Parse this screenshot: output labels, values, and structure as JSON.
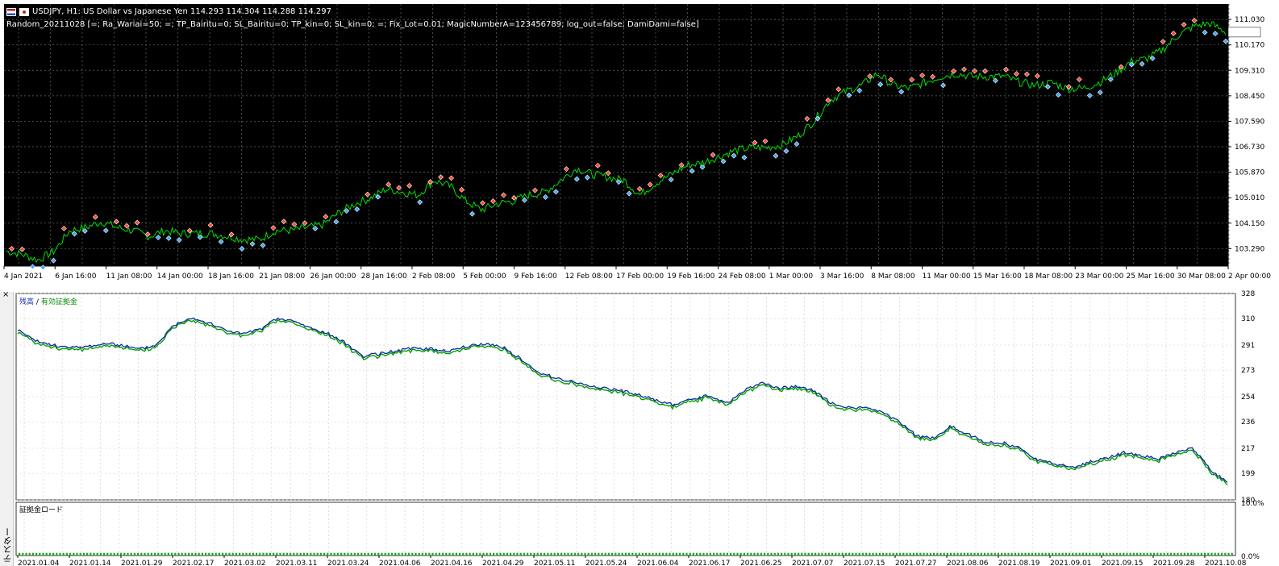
{
  "header": {
    "title": "USDJPY, H1:  US Dollar vs Japanese Yen  114.293 114.304 114.288 114.297",
    "params": "Random_20211028 [=; Ra_Wariai=50; =; TP_Bairitu=0; SL_Bairitu=0; TP_kin=0; SL_kin=0; =; Fix_Lot=0.01; MagicNumberA=123456789; log_out=false; DamiDami=false]",
    "icons": [
      "flag-icon",
      "jp-flag-icon"
    ]
  },
  "panel": {
    "tab_label": "テスター",
    "close_icon": "×",
    "legend_balance": "残高",
    "legend_separator": "/",
    "legend_equity": "有効証拠金",
    "load_title": "証拠金ロード"
  },
  "colors": {
    "price_line": "#00e000",
    "sell_marker": "#ff4a2a",
    "buy_marker": "#3aa8ff",
    "balance_line": "#0a2a9a",
    "equity_line": "#00a000",
    "load_bar": "#1fa61f"
  },
  "chart_data": [
    {
      "type": "line",
      "name": "price",
      "y_ticks": [
        "111.030",
        "110.170",
        "109.310",
        "108.450",
        "107.590",
        "106.730",
        "105.870",
        "105.010",
        "104.150",
        "103.290"
      ],
      "x_ticks": [
        "4 Jan 2021",
        "6 Jan 16:00",
        "11 Jan 08:00",
        "14 Jan 00:00",
        "18 Jan 16:00",
        "21 Jan 08:00",
        "26 Jan 00:00",
        "28 Jan 16:00",
        "2 Feb 08:00",
        "5 Feb 00:00",
        "9 Feb 16:00",
        "12 Feb 08:00",
        "17 Feb 00:00",
        "19 Feb 16:00",
        "24 Feb 08:00",
        "1 Mar 00:00",
        "3 Mar 16:00",
        "8 Mar 08:00",
        "11 Mar 00:00",
        "15 Mar 16:00",
        "18 Mar 08:00",
        "23 Mar 00:00",
        "25 Mar 16:00",
        "30 Mar 08:00",
        "2 Apr 00:00"
      ],
      "ylim": [
        102.7,
        111.55
      ],
      "grid": true,
      "series": [
        {
          "values": [
            103.2,
            103.1,
            102.9,
            103.2,
            103.9,
            104.0,
            104.2,
            104.0,
            103.9,
            103.7,
            103.9,
            103.8,
            103.8,
            103.8,
            103.7,
            103.6,
            103.6,
            103.9,
            103.9,
            104.0,
            104.1,
            104.5,
            104.8,
            105.0,
            105.3,
            105.2,
            105.1,
            105.6,
            105.4,
            104.9,
            104.6,
            104.8,
            104.9,
            105.1,
            105.2,
            105.6,
            106.0,
            105.8,
            105.7,
            105.6,
            105.1,
            105.5,
            105.8,
            106.1,
            106.2,
            106.4,
            106.6,
            106.7,
            106.7,
            106.8,
            107.1,
            107.6,
            108.3,
            108.6,
            108.8,
            109.2,
            108.8,
            108.7,
            108.9,
            109.1,
            109.2,
            109.1,
            109.1,
            109.1,
            108.9,
            108.8,
            108.9,
            108.7,
            108.7,
            108.9,
            109.2,
            109.6,
            109.7,
            110.0,
            110.5,
            110.8,
            110.9,
            110.6
          ]
        }
      ]
    },
    {
      "type": "line",
      "name": "balance",
      "y_ticks": [
        "328",
        "310",
        "291",
        "273",
        "254",
        "236",
        "217",
        "199",
        "180"
      ],
      "x_ticks": [
        "2021.01.04",
        "2021.01.14",
        "2021.01.29",
        "2021.02.17",
        "2021.03.02",
        "2021.03.11",
        "2021.03.24",
        "2021.04.06",
        "2021.04.16",
        "2021.04.29",
        "2021.05.11",
        "2021.05.24",
        "2021.06.04",
        "2021.06.17",
        "2021.06.25",
        "2021.07.07",
        "2021.07.15",
        "2021.07.27",
        "2021.08.06",
        "2021.08.19",
        "2021.09.01",
        "2021.09.15",
        "2021.09.28",
        "2021.10.08"
      ],
      "ylim": [
        180,
        328
      ],
      "grid": true,
      "series": [
        {
          "name": "残高",
          "values": [
            302,
            294,
            291,
            289,
            290,
            292,
            291,
            288,
            291,
            305,
            311,
            307,
            302,
            299,
            302,
            310,
            308,
            303,
            299,
            292,
            283,
            285,
            287,
            289,
            288,
            287,
            290,
            292,
            290,
            282,
            272,
            268,
            265,
            262,
            260,
            258,
            255,
            251,
            248,
            252,
            255,
            249,
            258,
            264,
            260,
            261,
            259,
            250,
            246,
            246,
            243,
            236,
            226,
            224,
            233,
            227,
            221,
            221,
            217,
            209,
            206,
            203,
            207,
            210,
            214,
            212,
            209,
            214,
            217,
            202,
            192
          ]
        }
      ]
    },
    {
      "type": "bar",
      "name": "margin_load",
      "y_ticks": [
        "10.0%",
        "0.0%"
      ],
      "ylim": [
        0,
        10
      ],
      "values": [
        0.5
      ]
    }
  ]
}
